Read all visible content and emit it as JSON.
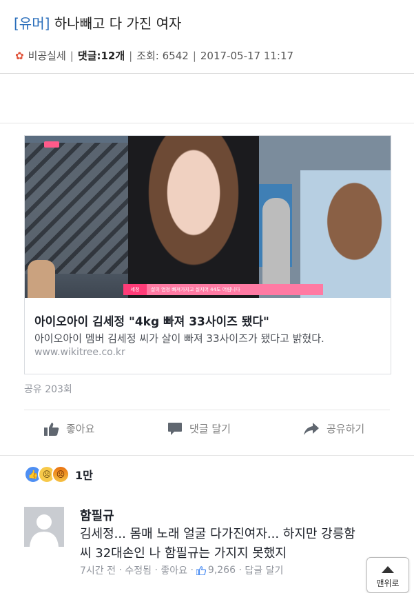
{
  "post": {
    "category": "[유머]",
    "title": "하나빼고 다 가진 여자",
    "author": "비공실세",
    "comments_label": "댓글:",
    "comments_count": "12개",
    "views_label": "조회:",
    "views": "6542",
    "datetime": "2017-05-17 11:17"
  },
  "card": {
    "caption_name": "세정",
    "caption_text": "살이 엄청 빠져가지고 실지어 44도 어림니다",
    "title": "아이오아이 김세정 \"4kg 빠져 33사이즈 됐다\"",
    "description": "아이오아이 멤버 김세정 씨가 살이 빠져 33사이즈가 됐다고 밝혔다.",
    "url": "www.wikitree.co.kr"
  },
  "share_count": "공유 203회",
  "actions": {
    "like": "좋아요",
    "comment": "댓글 달기",
    "share": "공유하기"
  },
  "reactions": {
    "count": "1만",
    "icons": [
      "like-icon",
      "sad-icon",
      "angry-icon"
    ]
  },
  "comment": {
    "name": "함필규",
    "line1": "김세정... 몸매 노래 얼굴 다가진여자... 하지만 강릉함",
    "line2": "씨 32대손인 나 함필규는 가지지 못했지",
    "time": "7시간 전",
    "edited": "수정됨",
    "like": "좋아요",
    "like_count": "9,266",
    "reply": "답글 달기"
  },
  "scroll_top": {
    "label": "맨위로"
  },
  "colors": {
    "category": "#2a6ebb",
    "facebook_blue": "#4e8ff3",
    "caption_pink": "#ff3c78"
  }
}
